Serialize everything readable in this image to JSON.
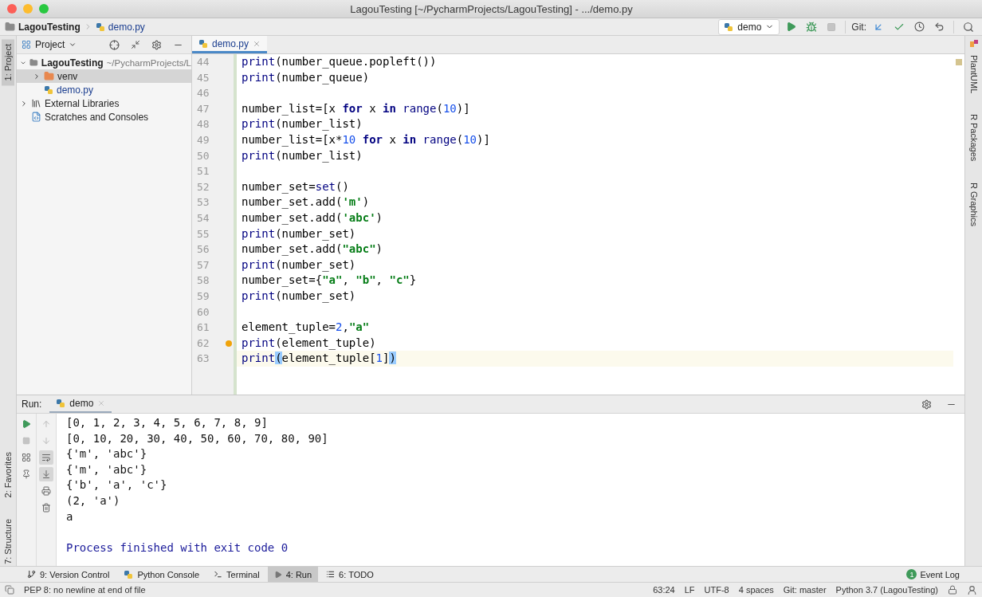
{
  "window": {
    "title": "LagouTesting [~/PycharmProjects/LagouTesting] - .../demo.py"
  },
  "breadcrumbs": [
    {
      "label": "LagouTesting",
      "kind": "folder"
    },
    {
      "label": "demo.py",
      "kind": "python"
    }
  ],
  "toolbar": {
    "run_config": "demo",
    "git_label": "Git:"
  },
  "left_stripe": [
    {
      "label": "1: Project",
      "selected": true
    },
    {
      "label": "2: Favorites",
      "selected": false
    },
    {
      "label": "7: Structure",
      "selected": false
    }
  ],
  "right_stripe": [
    {
      "label": "PlantUML"
    },
    {
      "label": "R Packages"
    },
    {
      "label": "R Graphics"
    }
  ],
  "project_panel": {
    "title": "Project",
    "tree": [
      {
        "label": "LagouTesting",
        "hint": "~/PycharmProjects/L",
        "kind": "folder",
        "expanded": true,
        "selected": false,
        "children": [
          {
            "label": "venv",
            "kind": "excluded",
            "expanded": false,
            "selected": true
          },
          {
            "label": "demo.py",
            "kind": "python",
            "selected": false
          }
        ]
      },
      {
        "label": "External Libraries",
        "kind": "libraries",
        "expanded": false,
        "selected": false
      },
      {
        "label": "Scratches and Consoles",
        "kind": "scratches",
        "selected": false
      }
    ]
  },
  "editor": {
    "tabs": [
      {
        "label": "demo.py",
        "selected": true
      }
    ],
    "lines": [
      {
        "number": "44",
        "current": false,
        "tokens": [
          {
            "kind": "builtin",
            "text": "print"
          },
          {
            "kind": "plain",
            "text": "(number_queue.popleft())"
          }
        ]
      },
      {
        "number": "45",
        "current": false,
        "tokens": [
          {
            "kind": "builtin",
            "text": "print"
          },
          {
            "kind": "plain",
            "text": "(number_queue)"
          }
        ]
      },
      {
        "number": "46",
        "current": false
      },
      {
        "number": "47",
        "current": false,
        "tokens": [
          {
            "kind": "plain",
            "text": "number_list=[x "
          },
          {
            "kind": "keyword",
            "text": "for"
          },
          {
            "kind": "plain",
            "text": " x "
          },
          {
            "kind": "keyword",
            "text": "in"
          },
          {
            "kind": "builtin",
            "text": " range"
          },
          {
            "kind": "plain",
            "text": "("
          },
          {
            "kind": "number",
            "text": "10"
          },
          {
            "kind": "plain",
            "text": ")]"
          }
        ]
      },
      {
        "number": "48",
        "current": false,
        "tokens": [
          {
            "kind": "builtin",
            "text": "print"
          },
          {
            "kind": "plain",
            "text": "(number_list)"
          }
        ]
      },
      {
        "number": "49",
        "current": false,
        "tokens": [
          {
            "kind": "plain",
            "text": "number_list=[x*"
          },
          {
            "kind": "number",
            "text": "10"
          },
          {
            "kind": "keyword",
            "text": " for"
          },
          {
            "kind": "plain",
            "text": " x "
          },
          {
            "kind": "keyword",
            "text": "in"
          },
          {
            "kind": "builtin",
            "text": " range"
          },
          {
            "kind": "plain",
            "text": "("
          },
          {
            "kind": "number",
            "text": "10"
          },
          {
            "kind": "plain",
            "text": ")]"
          }
        ]
      },
      {
        "number": "50",
        "current": false,
        "tokens": [
          {
            "kind": "builtin",
            "text": "print"
          },
          {
            "kind": "plain",
            "text": "(number_list)"
          }
        ]
      },
      {
        "number": "51",
        "current": false
      },
      {
        "number": "52",
        "current": false,
        "tokens": [
          {
            "kind": "plain",
            "text": "number_set="
          },
          {
            "kind": "builtin",
            "text": "set"
          },
          {
            "kind": "plain",
            "text": "()"
          }
        ]
      },
      {
        "number": "53",
        "current": false,
        "tokens": [
          {
            "kind": "plain",
            "text": "number_set.add("
          },
          {
            "kind": "string",
            "text": "'m'"
          },
          {
            "kind": "plain",
            "text": ")"
          }
        ]
      },
      {
        "number": "54",
        "current": false,
        "tokens": [
          {
            "kind": "plain",
            "text": "number_set.add("
          },
          {
            "kind": "string",
            "text": "'abc'"
          },
          {
            "kind": "plain",
            "text": ")"
          }
        ]
      },
      {
        "number": "55",
        "current": false,
        "tokens": [
          {
            "kind": "builtin",
            "text": "print"
          },
          {
            "kind": "plain",
            "text": "(number_set)"
          }
        ]
      },
      {
        "number": "56",
        "current": false,
        "tokens": [
          {
            "kind": "plain",
            "text": "number_set.add("
          },
          {
            "kind": "string",
            "text": "\"abc\""
          },
          {
            "kind": "plain",
            "text": ")"
          }
        ]
      },
      {
        "number": "57",
        "current": false,
        "tokens": [
          {
            "kind": "builtin",
            "text": "print"
          },
          {
            "kind": "plain",
            "text": "(number_set)"
          }
        ]
      },
      {
        "number": "58",
        "current": false,
        "tokens": [
          {
            "kind": "plain",
            "text": "number_set={"
          },
          {
            "kind": "string",
            "text": "\"a\""
          },
          {
            "kind": "plain",
            "text": ", "
          },
          {
            "kind": "string",
            "text": "\"b\""
          },
          {
            "kind": "plain",
            "text": ", "
          },
          {
            "kind": "string",
            "text": "\"c\""
          },
          {
            "kind": "plain",
            "text": "}"
          }
        ]
      },
      {
        "number": "59",
        "current": false,
        "tokens": [
          {
            "kind": "builtin",
            "text": "print"
          },
          {
            "kind": "plain",
            "text": "(number_set)"
          }
        ]
      },
      {
        "number": "60",
        "current": false
      },
      {
        "number": "61",
        "current": false,
        "tokens": [
          {
            "kind": "plain",
            "text": "element_tuple="
          },
          {
            "kind": "number",
            "text": "2"
          },
          {
            "kind": "plain",
            "text": ","
          },
          {
            "kind": "string",
            "text": "\"a\""
          }
        ]
      },
      {
        "number": "62",
        "current": false,
        "tokens": [
          {
            "kind": "builtin",
            "text": "print"
          },
          {
            "kind": "plain",
            "text": "(element_tuple)"
          }
        ]
      },
      {
        "number": "63",
        "current": true,
        "tokens": [
          {
            "kind": "builtin",
            "text": "print"
          },
          {
            "kind": "match",
            "text": "("
          },
          {
            "kind": "plain",
            "text": "element_tuple["
          },
          {
            "kind": "number",
            "text": "1"
          },
          {
            "kind": "plain",
            "text": "]"
          },
          {
            "kind": "match",
            "text": ")"
          }
        ]
      }
    ]
  },
  "run_panel": {
    "label": "Run:",
    "tabs": [
      {
        "label": "demo",
        "selected": true
      }
    ],
    "output": [
      {
        "kind": "stdout",
        "text": "[0, 1, 2, 3, 4, 5, 6, 7, 8, 9]"
      },
      {
        "kind": "stdout",
        "text": "[0, 10, 20, 30, 40, 50, 60, 70, 80, 90]"
      },
      {
        "kind": "stdout",
        "text": "{'m', 'abc'}"
      },
      {
        "kind": "stdout",
        "text": "{'m', 'abc'}"
      },
      {
        "kind": "stdout",
        "text": "{'b', 'a', 'c'}"
      },
      {
        "kind": "stdout",
        "text": "(2, 'a')"
      },
      {
        "kind": "stdout",
        "text": "a"
      },
      {
        "kind": "blank"
      },
      {
        "kind": "system",
        "text": "Process finished with exit code 0"
      }
    ]
  },
  "tool_windows": [
    {
      "label": "9: Version Control",
      "kind": "vcs",
      "selected": false
    },
    {
      "label": "Python Console",
      "kind": "python",
      "selected": false
    },
    {
      "label": "Terminal",
      "kind": "terminal",
      "selected": false
    },
    {
      "label": "4: Run",
      "kind": "run",
      "selected": true
    },
    {
      "label": "6: TODO",
      "kind": "todo",
      "selected": false
    }
  ],
  "event_log": {
    "badge": "1",
    "label": "Event Log"
  },
  "status_bar": {
    "message": "PEP 8: no newline at end of file",
    "items": [
      "63:24",
      "LF",
      "UTF-8",
      "4 spaces",
      "Git: master",
      "Python 3.7 (LagouTesting)"
    ]
  }
}
